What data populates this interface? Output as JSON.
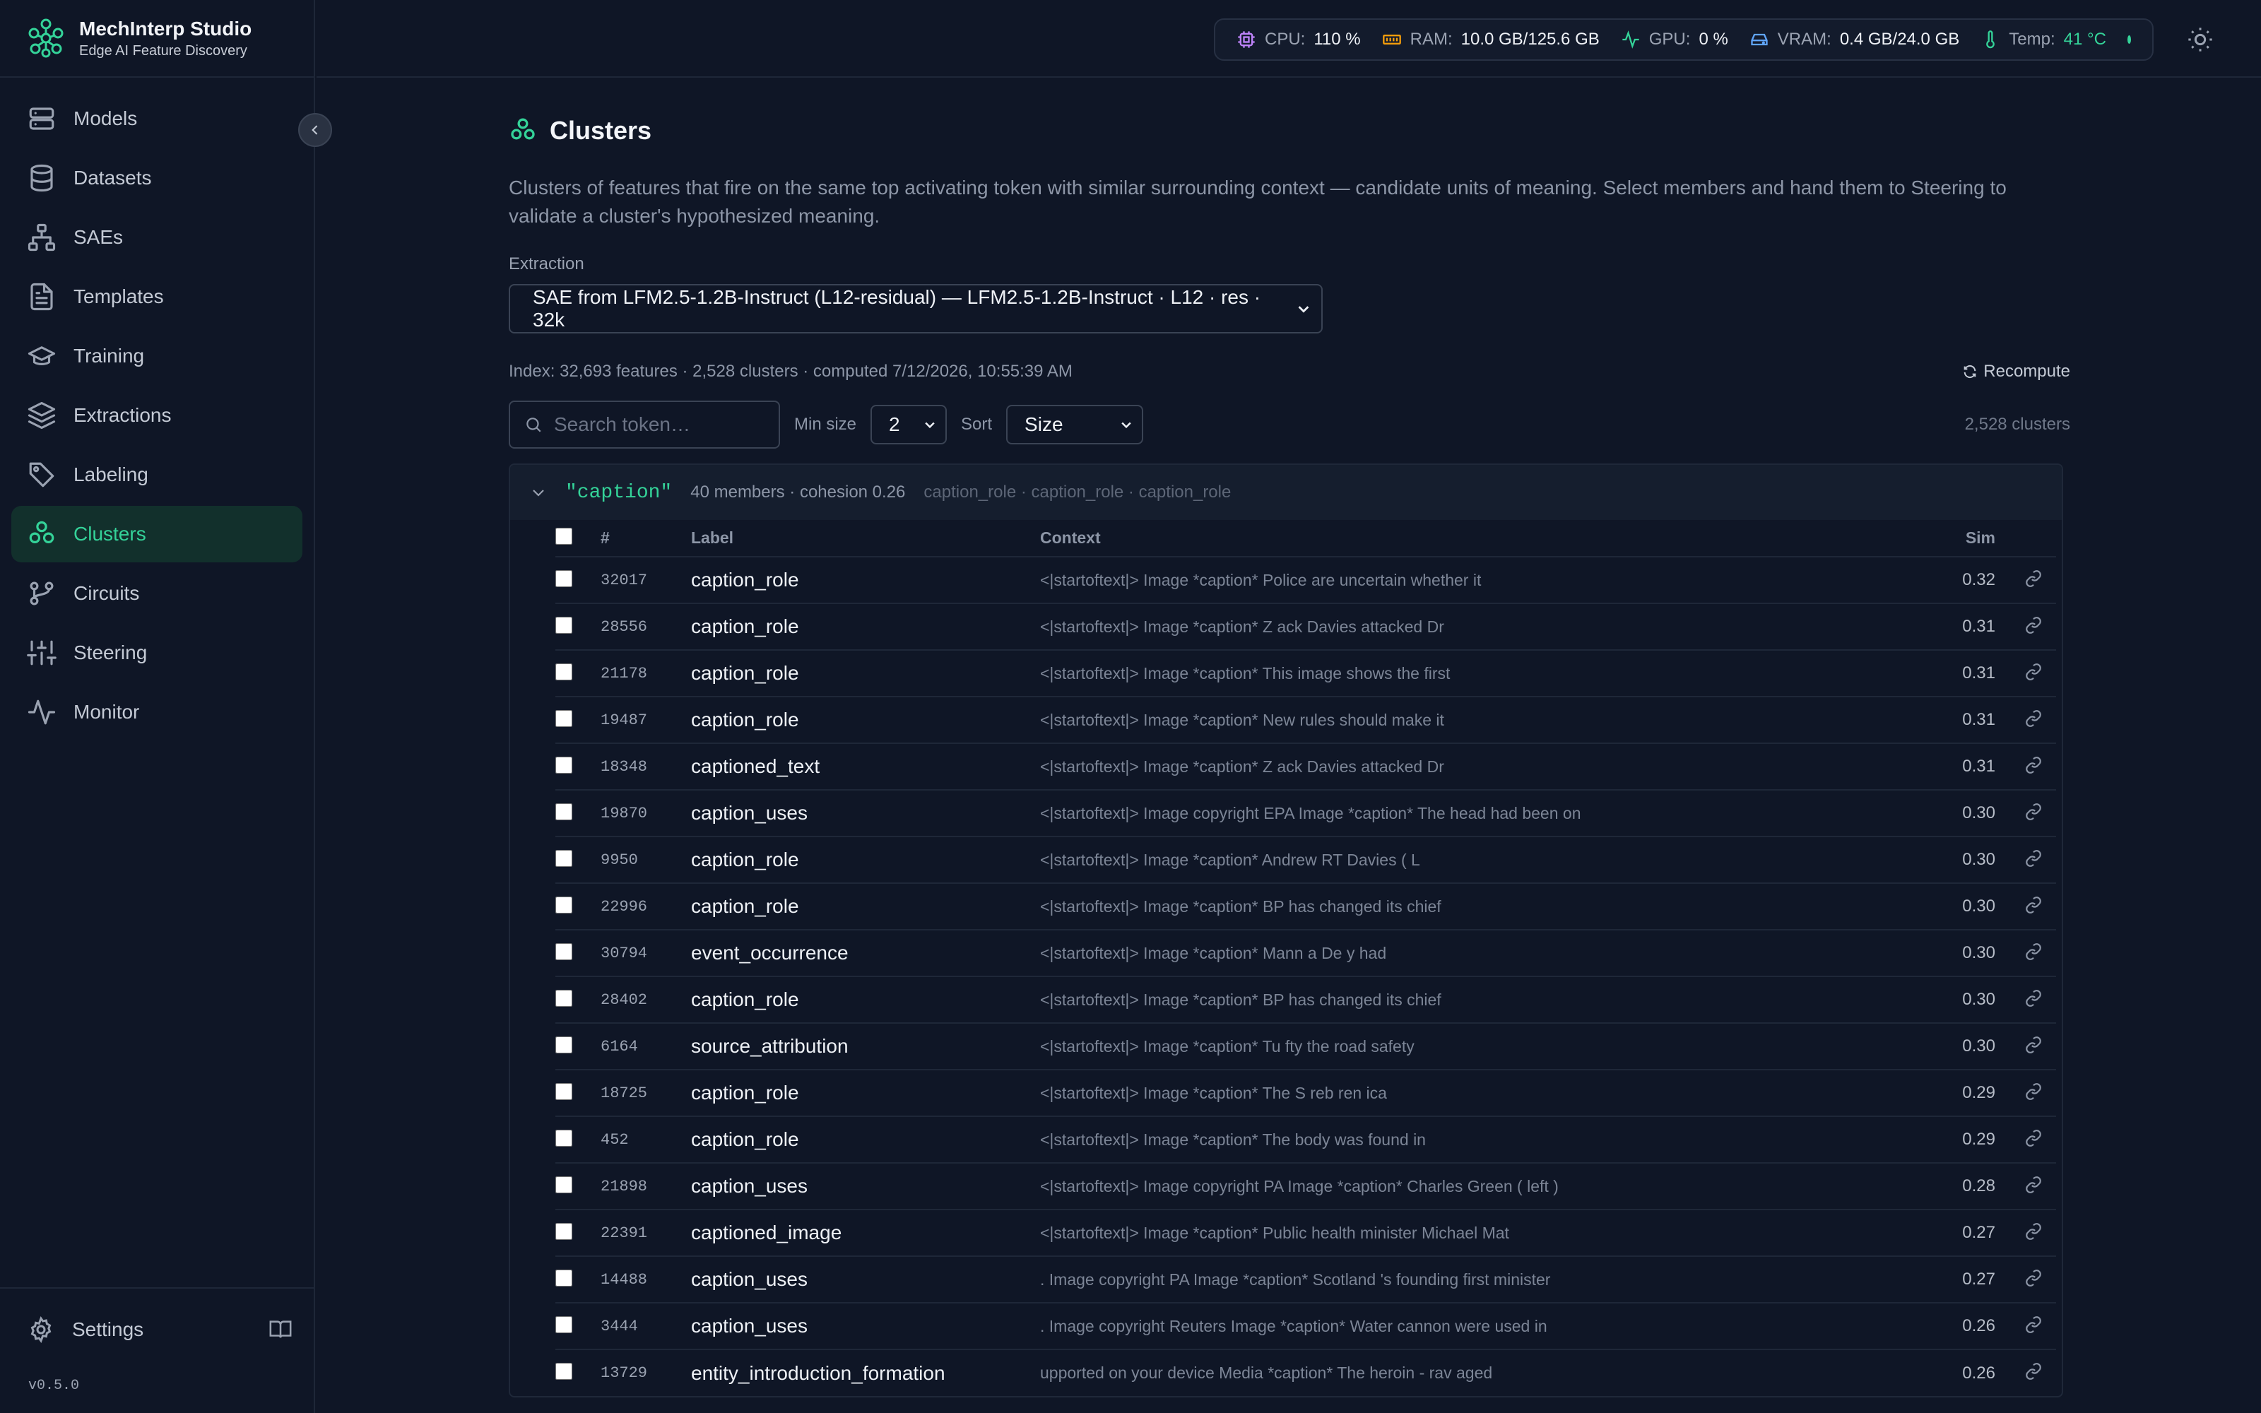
{
  "app": {
    "title": "MechInterp Studio",
    "subtitle": "Edge AI Feature Discovery",
    "version": "v0.5.0"
  },
  "nav": {
    "items": [
      {
        "label": "Models",
        "icon": "server-icon"
      },
      {
        "label": "Datasets",
        "icon": "database-icon"
      },
      {
        "label": "SAEs",
        "icon": "network-icon"
      },
      {
        "label": "Templates",
        "icon": "file-text-icon"
      },
      {
        "label": "Training",
        "icon": "graduation-cap-icon"
      },
      {
        "label": "Extractions",
        "icon": "layers-icon"
      },
      {
        "label": "Labeling",
        "icon": "tags-icon"
      },
      {
        "label": "Clusters",
        "icon": "clusters-icon",
        "active": true
      },
      {
        "label": "Circuits",
        "icon": "git-branch-icon"
      },
      {
        "label": "Steering",
        "icon": "sliders-icon"
      },
      {
        "label": "Monitor",
        "icon": "activity-icon"
      }
    ],
    "settings_label": "Settings"
  },
  "stats": {
    "cpu_label": "CPU:",
    "cpu_value": "110 %",
    "ram_label": "RAM:",
    "ram_value": "10.0 GB/125.6 GB",
    "gpu_label": "GPU:",
    "gpu_value": "0 %",
    "vram_label": "VRAM:",
    "vram_value": "0.4 GB/24.0 GB",
    "temp_label": "Temp:",
    "temp_value": "41 °C"
  },
  "page": {
    "title": "Clusters",
    "description": "Clusters of features that fire on the same top activating token with similar surrounding context — candidate units of meaning. Select members and hand them to Steering to validate a cluster's hypothesized meaning.",
    "extraction_label": "Extraction",
    "extraction_value": "SAE from LFM2.5-1.2B-Instruct (L12-residual) — LFM2.5-1.2B-Instruct · L12 · res · 32k",
    "index_info": "Index: 32,693 features · 2,528 clusters · computed 7/12/2026, 10:55:39 AM",
    "recompute_label": "Recompute",
    "search_placeholder": "Search token…",
    "min_size_label": "Min size",
    "min_size_value": "2",
    "sort_label": "Sort",
    "sort_value": "Size",
    "cluster_count": "2,528 clusters"
  },
  "cluster": {
    "token": "\"caption\"",
    "meta": "40 members · cohesion 0.26",
    "samples": "caption_role · caption_role · caption_role",
    "columns": {
      "id": "#",
      "label": "Label",
      "context": "Context",
      "sim": "Sim"
    },
    "rows": [
      {
        "id": "32017",
        "label": "caption_role",
        "context": "<|startoftext|> Image *caption* Police are uncertain whether it",
        "sim": "0.32"
      },
      {
        "id": "28556",
        "label": "caption_role",
        "context": "<|startoftext|> Image *caption* Z ack Davies attacked Dr",
        "sim": "0.31"
      },
      {
        "id": "21178",
        "label": "caption_role",
        "context": "<|startoftext|> Image *caption* This image shows the first",
        "sim": "0.31"
      },
      {
        "id": "19487",
        "label": "caption_role",
        "context": "<|startoftext|> Image *caption* New rules should make it",
        "sim": "0.31"
      },
      {
        "id": "18348",
        "label": "captioned_text",
        "context": "<|startoftext|> Image *caption* Z ack Davies attacked Dr",
        "sim": "0.31"
      },
      {
        "id": "19870",
        "label": "caption_uses",
        "context": "<|startoftext|> Image copyright EPA Image *caption* The head had been on",
        "sim": "0.30"
      },
      {
        "id": "9950",
        "label": "caption_role",
        "context": "<|startoftext|> Image *caption* Andrew RT Davies ( L",
        "sim": "0.30"
      },
      {
        "id": "22996",
        "label": "caption_role",
        "context": "<|startoftext|> Image *caption* BP has changed its chief",
        "sim": "0.30"
      },
      {
        "id": "30794",
        "label": "event_occurrence",
        "context": "<|startoftext|> Image *caption* Mann a De y had",
        "sim": "0.30"
      },
      {
        "id": "28402",
        "label": "caption_role",
        "context": "<|startoftext|> Image *caption* BP has changed its chief",
        "sim": "0.30"
      },
      {
        "id": "6164",
        "label": "source_attribution",
        "context": "<|startoftext|> Image *caption* Tu fty the road safety",
        "sim": "0.30"
      },
      {
        "id": "18725",
        "label": "caption_role",
        "context": "<|startoftext|> Image *caption* The S reb ren ica",
        "sim": "0.29"
      },
      {
        "id": "452",
        "label": "caption_role",
        "context": "<|startoftext|> Image *caption* The body was found in",
        "sim": "0.29"
      },
      {
        "id": "21898",
        "label": "caption_uses",
        "context": "<|startoftext|> Image copyright PA Image *caption* Charles Green ( left )",
        "sim": "0.28"
      },
      {
        "id": "22391",
        "label": "captioned_image",
        "context": "<|startoftext|> Image *caption* Public health minister Michael Mat",
        "sim": "0.27"
      },
      {
        "id": "14488",
        "label": "caption_uses",
        "context": ". Image copyright PA Image *caption* Scotland 's founding first minister",
        "sim": "0.27"
      },
      {
        "id": "3444",
        "label": "caption_uses",
        "context": ". Image copyright Reuters Image *caption* Water cannon were used in",
        "sim": "0.26"
      },
      {
        "id": "13729",
        "label": "entity_introduction_formation",
        "context": "upported on your device Media *caption* The heroin - rav aged",
        "sim": "0.26"
      }
    ]
  },
  "colors": {
    "accent": "#34d399",
    "background": "#0f1626",
    "cpu": "#c084fc",
    "ram": "#f59e0b",
    "gpu": "#34d399",
    "vram": "#60a5fa"
  }
}
